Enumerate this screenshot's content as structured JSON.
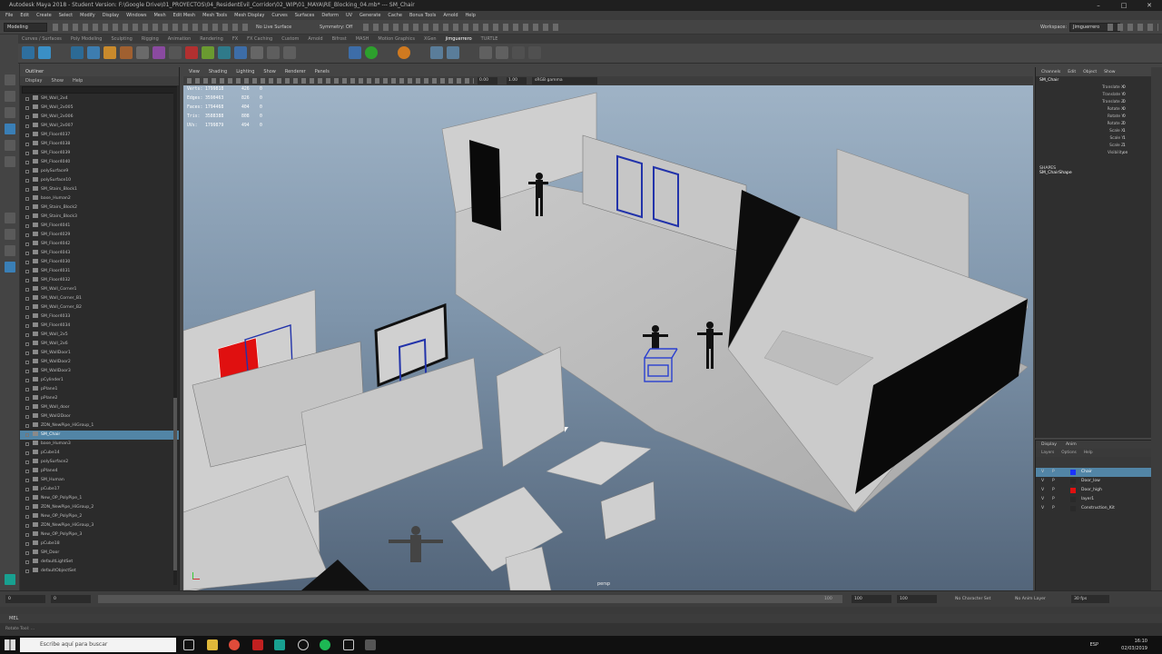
{
  "window": {
    "title": "Autodesk Maya 2018 - Student Version: F:\\Google Drive\\01_PROYECTOS\\04_ResidentEvil_Corridor\\02_WIP\\01_MAYA\\RE_Blocking_04.mb* --- SM_Chair",
    "controls": [
      "–",
      "□",
      "✕"
    ]
  },
  "menubar": [
    "File",
    "Edit",
    "Create",
    "Select",
    "Modify",
    "Display",
    "Windows",
    "Mesh",
    "Edit Mesh",
    "Mesh Tools",
    "Mesh Display",
    "Curves",
    "Surfaces",
    "Deform",
    "UV",
    "Generate",
    "Cache",
    "Bonus Tools",
    "Arnold",
    "Help"
  ],
  "status_line": {
    "menu_set": "Modeling",
    "live_surface": "No Live Surface",
    "symmetry": "Symmetry: Off",
    "workspace_label": "Workspace:",
    "workspace_value": "Jimguerrero"
  },
  "shelf_tabs": [
    "Curves / Surfaces",
    "Poly Modeling",
    "Sculpting",
    "Rigging",
    "Animation",
    "Rendering",
    "FX",
    "FX Caching",
    "Custom",
    "Arnold",
    "Bifrost",
    "MASH",
    "Motion Graphics",
    "XGen",
    "jimguerrero",
    "TURTLE"
  ],
  "active_shelf_tab": "jimguerrero",
  "outliner": {
    "title": "Outliner",
    "menu": [
      "Display",
      "Show",
      "Help"
    ],
    "items": [
      "SM_Wall_2x4",
      "SM_Wall_2x005",
      "SM_Wall_2x006",
      "SM_Wall_2x007",
      "SM_Floor4037",
      "SM_Floor4038",
      "SM_Floor4039",
      "SM_Floor4040",
      "polySurface9",
      "polySurface10",
      "SM_Stairs_Block1",
      "base_Human2",
      "SM_Stairs_Block2",
      "SM_Stairs_Block3",
      "SM_Floor4041",
      "SM_Floor4029",
      "SM_Floor4042",
      "SM_Floor4043",
      "SM_Floor4030",
      "SM_Floor4031",
      "SM_Floor4032",
      "SM_Wall_Corner1",
      "SM_Wall_Corner_B1",
      "SM_Wall_Corner_B2",
      "SM_Floor4033",
      "SM_Floor4034",
      "SM_Wall_2x5",
      "SM_Wall_2x6",
      "SM_WallDoor1",
      "SM_WallDoor2",
      "SM_WallDoor3",
      "pCylinder1",
      "pPlane1",
      "pPlane2",
      "SM_Wall_door",
      "SM_Wall2Door",
      "ZDN_NewPipe_HiGroup_1",
      "SM_Chair",
      "base_Human3",
      "pCube14",
      "polySurface2",
      "pPlane4",
      "SM_Human",
      "pCube17",
      "New_OP_PolyPipe_1",
      "ZDN_NewPipe_HiGroup_2",
      "New_OP_PolyPipe_2",
      "ZDN_NewPipe_HiGroup_3",
      "New_OP_PolyPipe_3",
      "pCube18",
      "SM_Door",
      "defaultLightSet",
      "defaultObjectSet"
    ],
    "selected": "SM_Chair"
  },
  "viewport": {
    "menu": [
      "View",
      "Shading",
      "Lighting",
      "Show",
      "Renderer",
      "Panels"
    ],
    "gamma": "sRGB gamma",
    "exposure": "0.00",
    "gamma_value": "1.00",
    "camera": "persp",
    "hud": [
      {
        "label": "Verts:",
        "total": "1799818",
        "sel": "426",
        "comp": "0"
      },
      {
        "label": "Edges:",
        "total": "3590463",
        "sel": "826",
        "comp": "0"
      },
      {
        "label": "Faces:",
        "total": "1794468",
        "sel": "404",
        "comp": "0"
      },
      {
        "label": "Tris:",
        "total": "3588388",
        "sel": "808",
        "comp": "0"
      },
      {
        "label": "UVs:",
        "total": "1799879",
        "sel": "494",
        "comp": "0"
      }
    ]
  },
  "channel_box": {
    "menu": [
      "Channels",
      "Edit",
      "Object",
      "Show"
    ],
    "node": "SM_Chair",
    "attributes": [
      {
        "name": "Translate X",
        "value": "0"
      },
      {
        "name": "Translate Y",
        "value": "0"
      },
      {
        "name": "Translate Z",
        "value": "0"
      },
      {
        "name": "Rotate X",
        "value": "0"
      },
      {
        "name": "Rotate Y",
        "value": "0"
      },
      {
        "name": "Rotate Z",
        "value": "0"
      },
      {
        "name": "Scale X",
        "value": "1"
      },
      {
        "name": "Scale Y",
        "value": "1"
      },
      {
        "name": "Scale Z",
        "value": "1"
      },
      {
        "name": "Visibility",
        "value": "on"
      }
    ],
    "shapes_label": "SHAPES",
    "shape_node": "SM_ChairShape"
  },
  "layer_editor": {
    "tabs": [
      "Display",
      "Anim"
    ],
    "menu": [
      "Layers",
      "Options",
      "Help"
    ],
    "layers": [
      {
        "name": "Chair",
        "color": "#1a33ff",
        "v": "V",
        "p": "P",
        "selected": true
      },
      {
        "name": "Door_low",
        "color": "#2a2a2a",
        "v": "V",
        "p": "P",
        "selected": false
      },
      {
        "name": "Door_high",
        "color": "#e01010",
        "v": "V",
        "p": "P",
        "selected": false
      },
      {
        "name": "layer1",
        "color": "#2a2a2a",
        "v": "V",
        "p": "P",
        "selected": false
      },
      {
        "name": "Construction_Kit",
        "color": "#2a2a2a",
        "v": "V",
        "p": "P",
        "selected": false
      }
    ]
  },
  "time_slider": {
    "start": "0",
    "current": "0",
    "end": "100",
    "range_start": "100",
    "range_end": "100",
    "character_set": "No Character Set",
    "anim_layer": "No Anim Layer",
    "fps": "30 fps"
  },
  "command_line": {
    "label": "MEL"
  },
  "help_line": "Rotate Tool: ...",
  "taskbar": {
    "search_placeholder": "Escribe aquí para buscar",
    "language": "ESP",
    "time": "16:10",
    "date": "02/03/2019"
  },
  "colors": {
    "selection": "#5285a6",
    "viewport_top": "#9fb3c6",
    "viewport_bottom": "#53657a",
    "red_highlight": "#e01010",
    "blue_wire": "#1a1aaa"
  }
}
